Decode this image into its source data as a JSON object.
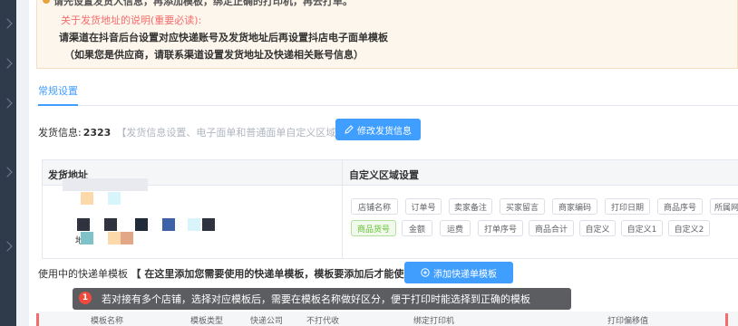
{
  "notice": {
    "line0": "请先设置发货人信息，再添加模板，绑定正确的打印机，再去打单。",
    "line1": "关于发货地址的说明(重要必读):",
    "line2": "请渠道在抖音后台设置对应快递账号及发货地址后再设置抖店电子面单模板",
    "line3": "（如果您是供应商，请联系渠道设置发货地址及快递相关账号信息）"
  },
  "tabs": {
    "active": "常规设置"
  },
  "shipping": {
    "label": "发货信息:",
    "count": "2323",
    "hint": "【发货信息设置、电子面单和普通面单自定义区域设置。】",
    "edit_button": "修改发货信息"
  },
  "table": {
    "col_address": "发货地址",
    "col_custom": "自定义区域设置",
    "address_prefix": "地",
    "tags_row1": [
      "店铺名称",
      "订单号",
      "卖家备注",
      "买家留言",
      "商家编码",
      "打印日期",
      "商品序号",
      "所属网点"
    ],
    "tags_row2": [
      "商品货号",
      "金额",
      "运费",
      "打单序号",
      "商品合计",
      "自定义",
      "自定义1",
      "自定义2"
    ]
  },
  "templates": {
    "label": "使用中的快递单模板",
    "bracket_text": "【 在这里添加您需要使用的快递单模板，模板要添加后才能使用哦。】",
    "add_button": "添加快递单模板"
  },
  "tooltip": {
    "badge": "1",
    "text": "若对接有多个店铺，选择对应模板后，需要在模板名称做好区分，便于打印时能选择到正确的模板"
  },
  "bottom_headers": [
    "模板名称",
    "模板类型",
    "快递公司",
    "不打代收",
    "绑定打印机",
    "打印偏移值"
  ],
  "colors": {
    "primary": "#409eff",
    "warning_text": "#f56c6c",
    "tag_green": "#67c23a"
  }
}
